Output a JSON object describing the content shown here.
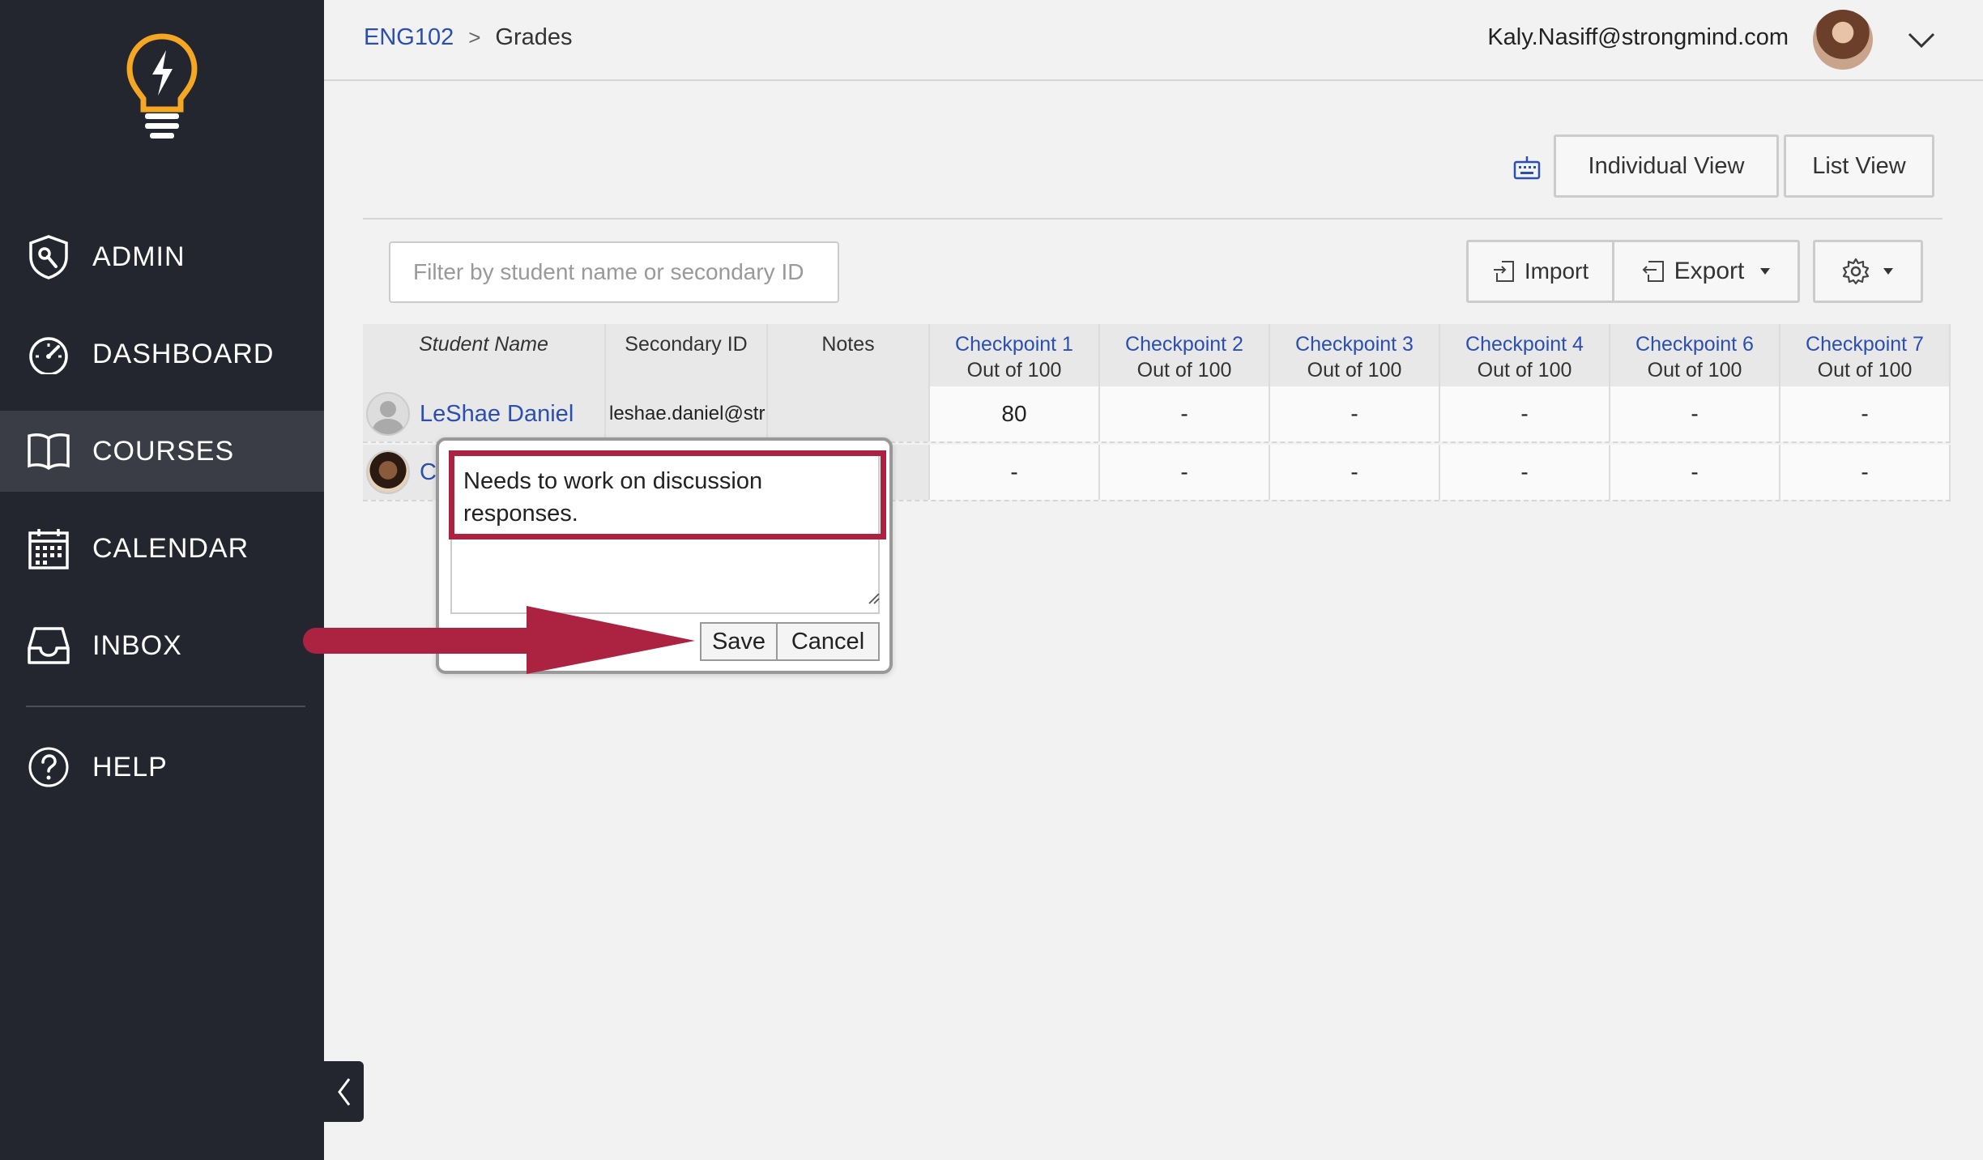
{
  "sidebar": {
    "items": [
      {
        "label": "ADMIN",
        "icon": "shield-wrench-icon"
      },
      {
        "label": "DASHBOARD",
        "icon": "speedometer-icon"
      },
      {
        "label": "COURSES",
        "icon": "book-icon",
        "active": true
      },
      {
        "label": "CALENDAR",
        "icon": "calendar-icon"
      },
      {
        "label": "INBOX",
        "icon": "inbox-icon"
      },
      {
        "label": "HELP",
        "icon": "help-circle-icon"
      }
    ]
  },
  "header": {
    "breadcrumb": {
      "course": "ENG102",
      "separator": ">",
      "current": "Grades"
    },
    "user_email": "Kaly.Nasiff@strongmind.com"
  },
  "views": {
    "individual": "Individual View",
    "list": "List View"
  },
  "filter": {
    "placeholder": "Filter by student name or secondary ID"
  },
  "toolbar": {
    "import": "Import",
    "export": "Export"
  },
  "table": {
    "headers": {
      "student": "Student Name",
      "secondary_id": "Secondary ID",
      "notes": "Notes"
    },
    "checkpoints": [
      {
        "title": "Checkpoint 1",
        "sub": "Out of 100"
      },
      {
        "title": "Checkpoint 2",
        "sub": "Out of 100"
      },
      {
        "title": "Checkpoint 3",
        "sub": "Out of 100"
      },
      {
        "title": "Checkpoint 4",
        "sub": "Out of 100"
      },
      {
        "title": "Checkpoint 6",
        "sub": "Out of 100"
      },
      {
        "title": "Checkpoint 7",
        "sub": "Out of 100"
      }
    ],
    "rows": [
      {
        "name": "LeShae Daniel",
        "secondary_id": "leshae.daniel@str",
        "notes": "",
        "scores": [
          "80",
          "-",
          "-",
          "-",
          "-",
          "-"
        ]
      },
      {
        "name": "C",
        "secondary_id": "",
        "notes": "",
        "scores": [
          "-",
          "-",
          "-",
          "-",
          "-",
          "-"
        ]
      }
    ]
  },
  "notes_popup": {
    "text": "Needs to work on discussion responses.",
    "save": "Save",
    "cancel": "Cancel"
  },
  "colors": {
    "sidebar_bg": "#23262e",
    "accent_link": "#2b4fb0",
    "annotation": "#ab2340",
    "logo": "#f5a623"
  }
}
